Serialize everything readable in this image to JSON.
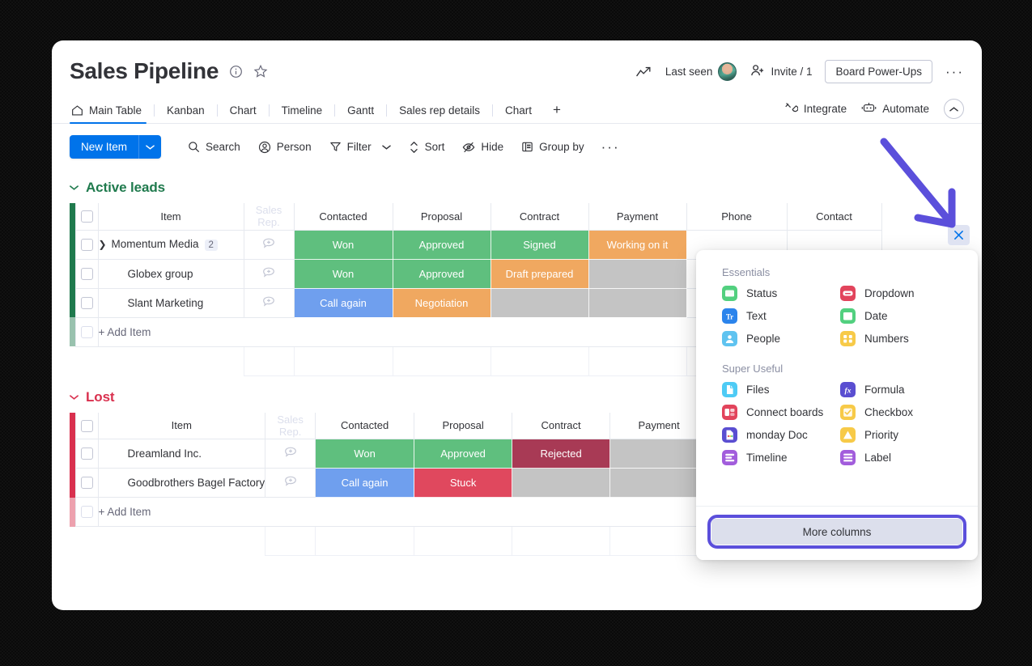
{
  "header": {
    "title": "Sales Pipeline",
    "info_icon": "info-circle-icon",
    "star_icon": "star-icon",
    "activity_icon": "activity-graph-icon",
    "last_seen": "Last seen",
    "invite": "Invite / 1",
    "power_ups": "Board Power-Ups",
    "more": "···"
  },
  "tabs": {
    "items": [
      {
        "label": "Main Table",
        "icon": "home-icon",
        "active": true
      },
      {
        "label": "Kanban",
        "active": false
      },
      {
        "label": "Chart",
        "active": false
      },
      {
        "label": "Timeline",
        "active": false
      },
      {
        "label": "Gantt",
        "active": false
      },
      {
        "label": "Sales rep details",
        "active": false
      },
      {
        "label": "Chart",
        "active": false
      }
    ],
    "add_label": "+",
    "integrate": "Integrate",
    "automate": "Automate",
    "collapse_icon": "chevron-up-icon"
  },
  "toolbar": {
    "new_item": "New Item",
    "new_item_caret": "chevron-down-icon",
    "items": [
      {
        "label": "Search",
        "icon": "search-icon"
      },
      {
        "label": "Person",
        "icon": "person-icon"
      },
      {
        "label": "Filter",
        "icon": "filter-icon",
        "caret": true
      },
      {
        "label": "Sort",
        "icon": "sort-icon"
      },
      {
        "label": "Hide",
        "icon": "eye-off-icon"
      },
      {
        "label": "Group by",
        "icon": "group-icon"
      }
    ],
    "more": "···"
  },
  "colors": {
    "green": "#5fbf7e",
    "orange": "#f0a860",
    "blue": "#6f9fee",
    "red": "#e0485e",
    "dark_red": "#a83a55",
    "grey": "#c4c4c4",
    "group_green": "#1f7a4d",
    "group_red": "#d9304e",
    "accent_blue": "#0073ea",
    "annotation_purple": "#5b4fdb"
  },
  "table": {
    "columns": [
      "Item",
      "Sales Rep.",
      "Contacted",
      "Proposal",
      "Contract",
      "Payment",
      "Phone",
      "Contact"
    ],
    "add_item_label": "+ Add Item"
  },
  "groups": [
    {
      "name": "Active leads",
      "color": "#1f7a4d",
      "caret": "chevron-down-icon",
      "rows": [
        {
          "name": "Momentum Media",
          "expandable": true,
          "subitem_count": "2",
          "cells": [
            {
              "text": "Won",
              "color": "#5fbf7e"
            },
            {
              "text": "Approved",
              "color": "#5fbf7e"
            },
            {
              "text": "Signed",
              "color": "#5fbf7e"
            },
            {
              "text": "Working on it",
              "color": "#f0a860"
            },
            {
              "text": "",
              "color": "#ffffff"
            },
            {
              "text": "",
              "color": "#ffffff"
            }
          ]
        },
        {
          "name": "Globex group",
          "expandable": false,
          "subitem_count": "",
          "cells": [
            {
              "text": "Won",
              "color": "#5fbf7e"
            },
            {
              "text": "Approved",
              "color": "#5fbf7e"
            },
            {
              "text": "Draft prepared",
              "color": "#f0a860"
            },
            {
              "text": "",
              "color": "#c4c4c4"
            },
            {
              "text": "",
              "color": "#ffffff"
            },
            {
              "text": "",
              "color": "#ffffff"
            }
          ]
        },
        {
          "name": "Slant Marketing",
          "expandable": false,
          "subitem_count": "",
          "cells": [
            {
              "text": "Call again",
              "color": "#6f9fee"
            },
            {
              "text": "Negotiation",
              "color": "#f0a860"
            },
            {
              "text": "",
              "color": "#c4c4c4"
            },
            {
              "text": "",
              "color": "#c4c4c4"
            },
            {
              "text": "",
              "color": "#ffffff"
            },
            {
              "text": "",
              "color": "#ffffff"
            }
          ]
        }
      ]
    },
    {
      "name": "Lost",
      "color": "#d9304e",
      "caret": "chevron-down-icon",
      "rows": [
        {
          "name": "Dreamland Inc.",
          "expandable": false,
          "subitem_count": "",
          "cells": [
            {
              "text": "Won",
              "color": "#5fbf7e"
            },
            {
              "text": "Approved",
              "color": "#5fbf7e"
            },
            {
              "text": "Rejected",
              "color": "#a83a55"
            },
            {
              "text": "",
              "color": "#c4c4c4"
            },
            {
              "text": "",
              "color": "#ffffff"
            },
            {
              "text": "",
              "color": "#ffffff"
            }
          ]
        },
        {
          "name": "Goodbrothers Bagel Factory",
          "expandable": false,
          "subitem_count": "",
          "cells": [
            {
              "text": "Call again",
              "color": "#6f9fee"
            },
            {
              "text": "Stuck",
              "color": "#e0485e"
            },
            {
              "text": "",
              "color": "#c4c4c4"
            },
            {
              "text": "",
              "color": "#c4c4c4"
            },
            {
              "text": "",
              "color": "#ffffff"
            },
            {
              "text": "",
              "color": "#ffffff"
            }
          ]
        }
      ]
    }
  ],
  "column_picker": {
    "sections": [
      {
        "title": "Essentials",
        "items": [
          {
            "label": "Status",
            "icon": "status-icon",
            "color": "#52d07f"
          },
          {
            "label": "Dropdown",
            "icon": "dropdown-icon",
            "color": "#e2445c"
          },
          {
            "label": "Text",
            "icon": "text-icon",
            "color": "#2b84ec"
          },
          {
            "label": "Date",
            "icon": "date-icon",
            "color": "#52d07f"
          },
          {
            "label": "People",
            "icon": "people-icon",
            "color": "#5fc3f0"
          },
          {
            "label": "Numbers",
            "icon": "numbers-icon",
            "color": "#f7ca48"
          }
        ]
      },
      {
        "title": "Super Useful",
        "items": [
          {
            "label": "Files",
            "icon": "files-icon",
            "color": "#4ecbf5"
          },
          {
            "label": "Formula",
            "icon": "formula-icon",
            "color": "#5a4ed1"
          },
          {
            "label": "Connect boards",
            "icon": "connect-boards-icon",
            "color": "#e2445c"
          },
          {
            "label": "Checkbox",
            "icon": "checkbox-icon",
            "color": "#f7ca48"
          },
          {
            "label": "monday Doc",
            "icon": "monday-doc-icon",
            "color": "#5a4ed1"
          },
          {
            "label": "Priority",
            "icon": "priority-icon",
            "color": "#f7ca48"
          },
          {
            "label": "Timeline",
            "icon": "timeline-icon",
            "color": "#a25ddc"
          },
          {
            "label": "Label",
            "icon": "label-icon",
            "color": "#a25ddc"
          }
        ]
      }
    ],
    "more_columns": "More columns"
  },
  "annotations": {
    "arrow_target": "close-column-picker-x-button",
    "close_x": "×",
    "highlight_target": "More columns"
  }
}
